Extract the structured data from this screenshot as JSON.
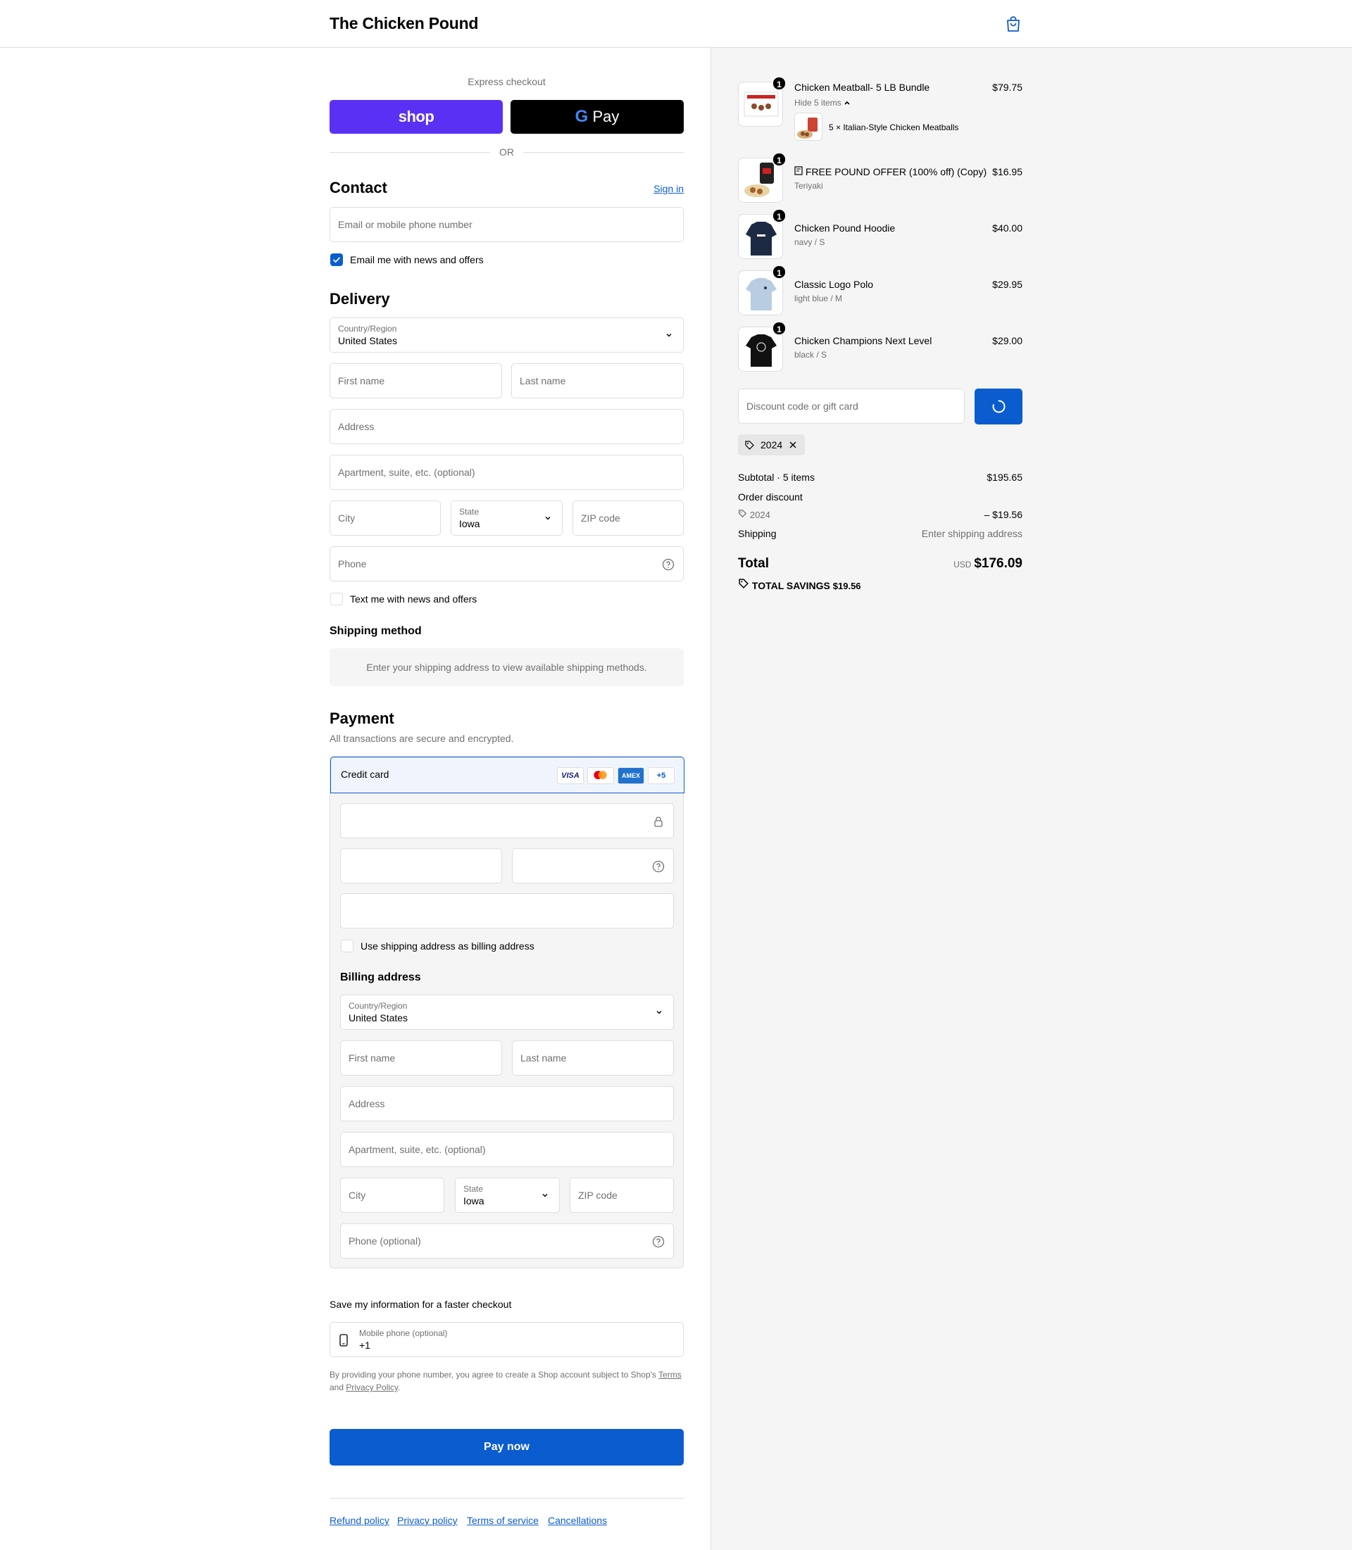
{
  "header": {
    "brand": "The Chicken Pound"
  },
  "express": {
    "title": "Express checkout",
    "shop_label": "shop",
    "gpay_label": "Pay",
    "or_label": "OR"
  },
  "contact": {
    "heading": "Contact",
    "sign_in": "Sign in",
    "email_placeholder": "Email or mobile phone number",
    "email_optin": "Email me with news and offers"
  },
  "delivery": {
    "heading": "Delivery",
    "country_label": "Country/Region",
    "country_value": "United States",
    "first_name": "First name",
    "last_name": "Last name",
    "address": "Address",
    "apartment": "Apartment, suite, etc. (optional)",
    "city": "City",
    "state_label": "State",
    "state_value": "Iowa",
    "zip": "ZIP code",
    "phone": "Phone",
    "text_optin": "Text me with news and offers"
  },
  "shipping_method": {
    "heading": "Shipping method",
    "message": "Enter your shipping address to view available shipping methods."
  },
  "payment": {
    "heading": "Payment",
    "subtitle": "All transactions are secure and encrypted.",
    "credit_card": "Credit card",
    "card_visa": "VISA",
    "card_amex": "AMEX",
    "card_more": "+5",
    "use_shipping": "Use shipping address as billing address"
  },
  "billing": {
    "heading": "Billing address",
    "country_label": "Country/Region",
    "country_value": "United States",
    "first_name": "First name",
    "last_name": "Last name",
    "address": "Address",
    "apartment": "Apartment, suite, etc. (optional)",
    "city": "City",
    "state_label": "State",
    "state_value": "Iowa",
    "zip": "ZIP code",
    "phone": "Phone (optional)"
  },
  "save_info": {
    "heading": "Save my information for a faster checkout",
    "mobile_label": "Mobile phone (optional)",
    "mobile_value": "+1",
    "legal_prefix": "By providing your phone number, you agree to create a Shop account subject to Shop's",
    "terms": "Terms",
    "and": "and",
    "privacy": "Privacy Policy",
    "period": "."
  },
  "pay_now": "Pay now",
  "footer": {
    "refund": "Refund policy",
    "privacy": "Privacy policy",
    "terms": "Terms of service",
    "cancellations": "Cancellations"
  },
  "cart": {
    "items": [
      {
        "name": "Chicken Meatball- 5 LB Bundle",
        "variant": "Hide 5 items",
        "price": "$79.75",
        "qty": "1",
        "sub": "5 × Italian-Style Chicken Meatballs"
      },
      {
        "name": "FREE POUND OFFER (100% off) (Copy)",
        "variant": "Teriyaki",
        "price": "$16.95",
        "qty": "1"
      },
      {
        "name": "Chicken Pound Hoodie",
        "variant": "navy / S",
        "price": "$40.00",
        "qty": "1"
      },
      {
        "name": "Classic Logo Polo",
        "variant": "light blue / M",
        "price": "$29.95",
        "qty": "1"
      },
      {
        "name": "Chicken Champions Next Level",
        "variant": "black / S",
        "price": "$29.00",
        "qty": "1"
      }
    ],
    "discount_placeholder": "Discount code or gift card",
    "applied_code": "2024"
  },
  "summary": {
    "subtotal_label": "Subtotal · 5 items",
    "subtotal_value": "$195.65",
    "order_discount_label": "Order discount",
    "discount_code": "2024",
    "discount_value": "– $19.56",
    "shipping_label": "Shipping",
    "shipping_value": "Enter shipping address",
    "total_label": "Total",
    "currency": "USD",
    "total_value": "$176.09",
    "savings_label": "TOTAL SAVINGS",
    "savings_value": "$19.56"
  },
  "colors": {
    "accent": "#0b5ccf",
    "shop": "#5a31f4"
  }
}
